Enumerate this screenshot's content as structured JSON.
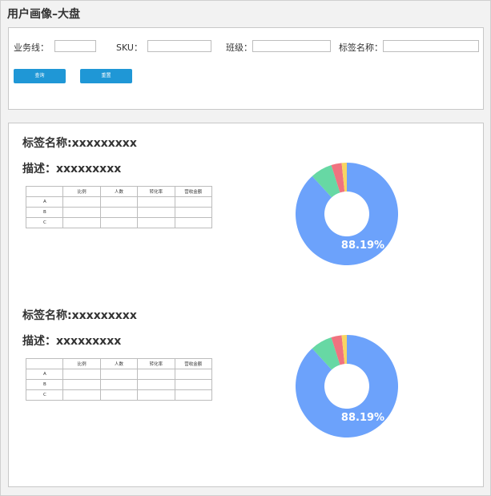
{
  "page": {
    "title": "用户画像–大盘"
  },
  "filters": {
    "business_line": {
      "label": "业务线：",
      "value": ""
    },
    "sku": {
      "label": "SKU：",
      "value": ""
    },
    "class": {
      "label": "班级：",
      "value": ""
    },
    "tag_name": {
      "label": "标签名称：",
      "value": ""
    },
    "query_label": "查询",
    "reset_label": "重置"
  },
  "table_header": [
    "",
    "比例",
    "人数",
    "转化率",
    "营收金额"
  ],
  "table_rows": [
    "A",
    "B",
    "C"
  ],
  "cards": [
    {
      "tag_title": "标签名称:xxxxxxxxx",
      "description": "描述：xxxxxxxxx",
      "chart_data": {
        "type": "pie",
        "style": "donut",
        "categories": [
          "blue",
          "green",
          "red",
          "yellow"
        ],
        "values": [
          88.19,
          6.9,
          3.3,
          1.61
        ],
        "colors": [
          "#6ca2fb",
          "#67d8a4",
          "#f0737f",
          "#f8d562"
        ],
        "data_labels": [
          "88.19%"
        ]
      }
    },
    {
      "tag_title": "标签名称:xxxxxxxxx",
      "description": "描述：xxxxxxxxx",
      "chart_data": {
        "type": "pie",
        "style": "donut",
        "categories": [
          "blue",
          "green",
          "red",
          "yellow"
        ],
        "values": [
          88.19,
          6.9,
          3.3,
          1.61
        ],
        "colors": [
          "#6ca2fb",
          "#67d8a4",
          "#f0737f",
          "#f8d562"
        ],
        "data_labels": [
          "88.19%"
        ]
      }
    }
  ]
}
